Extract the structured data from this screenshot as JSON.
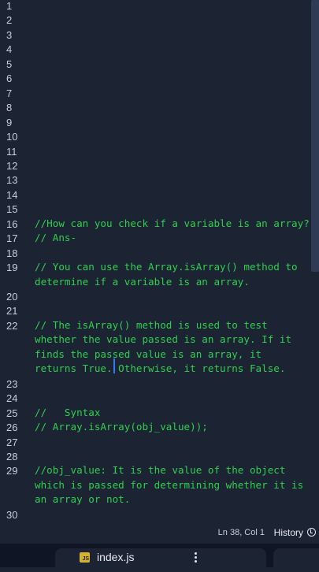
{
  "editor": {
    "lines": [
      {
        "n": "1",
        "code": ""
      },
      {
        "n": "2",
        "code": ""
      },
      {
        "n": "3",
        "code": ""
      },
      {
        "n": "4",
        "code": ""
      },
      {
        "n": "5",
        "code": ""
      },
      {
        "n": "6",
        "code": ""
      },
      {
        "n": "7",
        "code": ""
      },
      {
        "n": "8",
        "code": ""
      },
      {
        "n": "9",
        "code": ""
      },
      {
        "n": "10",
        "code": ""
      },
      {
        "n": "11",
        "code": ""
      },
      {
        "n": "12",
        "code": ""
      },
      {
        "n": "13",
        "code": ""
      },
      {
        "n": "14",
        "code": ""
      },
      {
        "n": "15",
        "code": ""
      },
      {
        "n": "16",
        "code": "//How can you check if a variable is an array?"
      },
      {
        "n": "17",
        "code": "// Ans-"
      },
      {
        "n": "18",
        "code": ""
      },
      {
        "n": "19",
        "code": "// You can use the Array.isArray() method to\ndetermine if a variable is an array."
      },
      {
        "n": "20",
        "code": ""
      },
      {
        "n": "21",
        "code": ""
      },
      {
        "n": "22",
        "code": "// The isArray() method is used to test\nwhether the value passed is an array. If it\nfinds the passed value is an array, it\nreturns True. Otherwise, it returns False."
      },
      {
        "n": "23",
        "code": ""
      },
      {
        "n": "24",
        "code": ""
      },
      {
        "n": "25",
        "code": "//   Syntax"
      },
      {
        "n": "26",
        "code": "// Array.isArray(obj_value));"
      },
      {
        "n": "27",
        "code": ""
      },
      {
        "n": "28",
        "code": ""
      },
      {
        "n": "29",
        "code": "//obj_value: It is the value of the object\nwhich is passed for determining whether it is\nan array or not."
      },
      {
        "n": "30",
        "code": ""
      }
    ]
  },
  "status": {
    "position": "Ln 38, Col 1",
    "history_label": "History"
  },
  "tab": {
    "filename": "index.js",
    "file_icon_text": "JS"
  },
  "colors": {
    "background": "#1c2333",
    "comment_text": "#31cf4f",
    "line_number": "#c9ced8",
    "cursor": "#2f7bf6"
  }
}
